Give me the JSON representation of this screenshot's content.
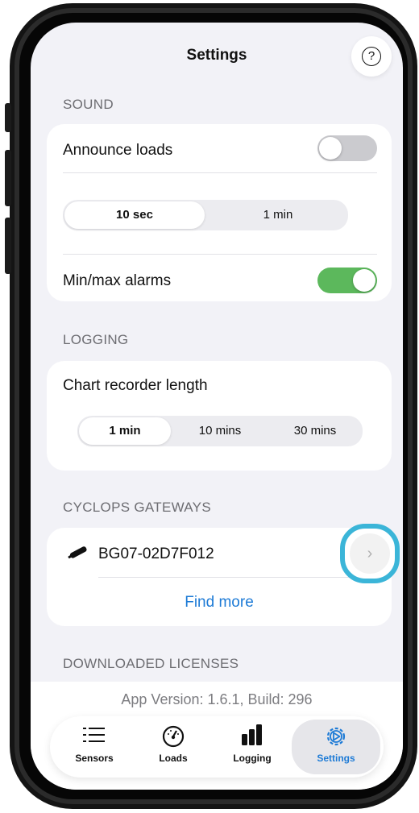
{
  "header": {
    "title": "Settings",
    "help_label": "?"
  },
  "sound": {
    "section_title": "SOUND",
    "announce_label": "Announce loads",
    "announce_on": false,
    "interval_options": [
      "10 sec",
      "1 min"
    ],
    "interval_selected": "10 sec",
    "alarms_label": "Min/max alarms",
    "alarms_on": true
  },
  "logging": {
    "section_title": "LOGGING",
    "chart_label": "Chart recorder length",
    "length_options": [
      "1 min",
      "10 mins",
      "30 mins"
    ],
    "length_selected": "1 min"
  },
  "gateways": {
    "section_title": "CYCLOPS GATEWAYS",
    "items": [
      {
        "name": "BG07-02D7F012"
      }
    ],
    "find_more": "Find more"
  },
  "licenses": {
    "section_title": "DOWNLOADED LICENSES"
  },
  "footer": {
    "version": "App Version: 1.6.1,  Build: 296"
  },
  "tabs": [
    {
      "label": "Sensors",
      "icon": "list-icon"
    },
    {
      "label": "Loads",
      "icon": "gauge-icon"
    },
    {
      "label": "Logging",
      "icon": "bar-chart-icon"
    },
    {
      "label": "Settings",
      "icon": "gear-icon",
      "active": true
    }
  ],
  "colors": {
    "accent": "#1e7bd6",
    "toggle_on": "#5cb85c",
    "highlight_ring": "#3bb5d8"
  }
}
